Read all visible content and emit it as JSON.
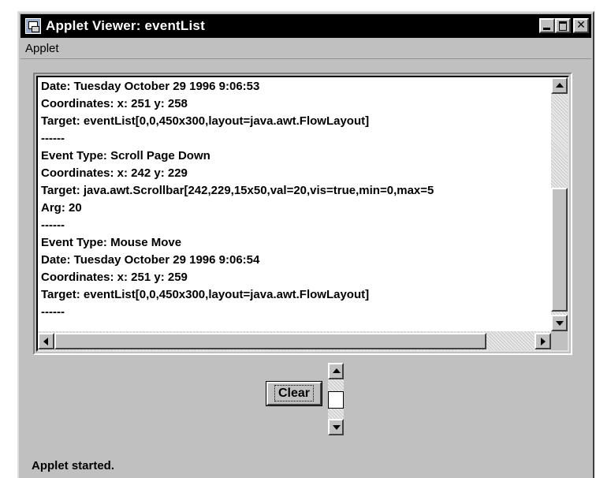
{
  "window": {
    "title": "Applet Viewer: eventList",
    "buttons": {
      "minimize": "_",
      "maximize": "□",
      "close": "✕"
    }
  },
  "menu": {
    "items": [
      {
        "label": "Applet"
      }
    ]
  },
  "event_log": {
    "lines": [
      "Date: Tuesday October 29 1996 9:06:53",
      "Coordinates: x: 251 y: 258",
      "Target: eventList[0,0,450x300,layout=java.awt.FlowLayout]",
      "------",
      "Event Type: Scroll Page Down",
      "Coordinates: x: 242 y: 229",
      "Target: java.awt.Scrollbar[242,229,15x50,val=20,vis=true,min=0,max=5",
      "Arg: 20",
      "------",
      "Event Type: Mouse Move",
      "Date: Tuesday October 29 1996 9:06:54",
      "Coordinates: x: 251 y: 259",
      "Target: eventList[0,0,450x300,layout=java.awt.FlowLayout]",
      "------"
    ],
    "vertical_scroll_position": 1.0,
    "horizontal_scroll_position": 0.0
  },
  "controls": {
    "clear_label": "Clear"
  },
  "status": {
    "text": "Applet started."
  },
  "icons": {
    "app": "applet-window-icon",
    "minimize": "minimize-icon",
    "maximize": "maximize-icon",
    "close": "close-icon",
    "scroll_up": "arrow-up-icon",
    "scroll_down": "arrow-down-icon",
    "scroll_left": "arrow-left-icon",
    "scroll_right": "arrow-right-icon"
  },
  "colors": {
    "titlebar": "#000000",
    "face": "#c0c0c0",
    "text_area": "#ffffff"
  }
}
